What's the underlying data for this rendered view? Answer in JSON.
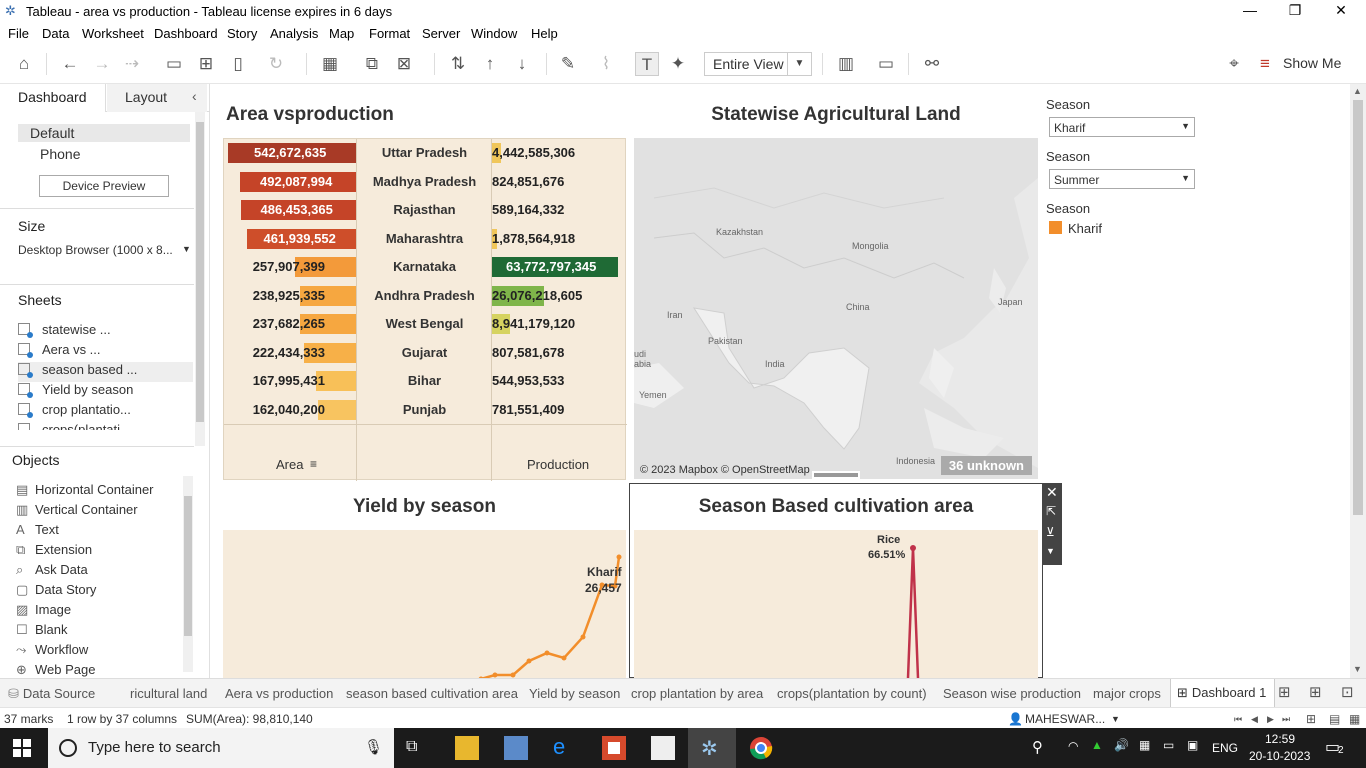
{
  "window": {
    "title": "Tableau - area vs production - Tableau license expires in 6 days"
  },
  "menu": [
    "File",
    "Data",
    "Worksheet",
    "Dashboard",
    "Story",
    "Analysis",
    "Map",
    "Format",
    "Server",
    "Window",
    "Help"
  ],
  "toolbar": {
    "fit": "Entire View",
    "show_me": "Show Me"
  },
  "left": {
    "tab_dashboard": "Dashboard",
    "tab_layout": "Layout",
    "device_default": "Default",
    "device_phone": "Phone",
    "device_preview": "Device Preview",
    "size_label": "Size",
    "size_value": "Desktop Browser (1000 x 8...",
    "sheets_label": "Sheets",
    "sheets": [
      "statewise ...",
      "Aera vs ...",
      "season based ...",
      "Yield by season",
      "crop plantatio...",
      "crops(plantati..."
    ],
    "objects_label": "Objects",
    "objects": [
      {
        "icon": "▤",
        "label": "Horizontal Container"
      },
      {
        "icon": "▥",
        "label": "Vertical Container"
      },
      {
        "icon": "A",
        "label": "Text"
      },
      {
        "icon": "⧉",
        "label": "Extension"
      },
      {
        "icon": "⌕",
        "label": "Ask Data"
      },
      {
        "icon": "▢",
        "label": "Data Story"
      },
      {
        "icon": "▨",
        "label": "Image"
      },
      {
        "icon": "☐",
        "label": "Blank"
      },
      {
        "icon": "⤳",
        "label": "Workflow"
      },
      {
        "icon": "⊕",
        "label": "Web Page"
      }
    ]
  },
  "area_vs_production": {
    "title": "Area vsproduction",
    "area_header": "Area",
    "production_header": "Production",
    "rows": [
      {
        "state": "Uttar Pradesh",
        "area": "542,672,635",
        "production": "4,442,585,306",
        "area_color": "#a83a26",
        "prod_color": "#f0c65a"
      },
      {
        "state": "Madhya Pradesh",
        "area": "492,087,994",
        "production": "824,851,676",
        "area_color": "#c54428",
        "prod_color": ""
      },
      {
        "state": "Rajasthan",
        "area": "486,453,365",
        "production": "589,164,332",
        "area_color": "#c54428",
        "prod_color": ""
      },
      {
        "state": "Maharashtra",
        "area": "461,939,552",
        "production": "1,878,564,918",
        "area_color": "#ce4e2a",
        "prod_color": "#f0c65a"
      },
      {
        "state": "Karnataka",
        "area": "257,907,399",
        "production": "63,772,797,345",
        "area_color": "#f39a3a",
        "prod_color": "#1f6a35"
      },
      {
        "state": "Andhra Pradesh",
        "area": "238,925,335",
        "production": "26,076,218,605",
        "area_color": "#f6a740",
        "prod_color": "#7fb54a"
      },
      {
        "state": "West Bengal",
        "area": "237,682,265",
        "production": "8,941,179,120",
        "area_color": "#f6a740",
        "prod_color": "#d6d360"
      },
      {
        "state": "Gujarat",
        "area": "222,434,333",
        "production": "807,581,678",
        "area_color": "#f7b048",
        "prod_color": ""
      },
      {
        "state": "Bihar",
        "area": "167,995,431",
        "production": "544,953,533",
        "area_color": "#f8c058",
        "prod_color": ""
      },
      {
        "state": "Punjab",
        "area": "162,040,200",
        "production": "781,551,409",
        "area_color": "#f8c460",
        "prod_color": ""
      }
    ]
  },
  "map": {
    "title": "Statewise Agricultural Land",
    "credit": "© 2023 Mapbox © OpenStreetMap",
    "unknown": "36 unknown",
    "labels": [
      {
        "t": "Kazakhstan"
      },
      {
        "t": "Mongolia"
      },
      {
        "t": "China"
      },
      {
        "t": "Japan"
      },
      {
        "t": "Iran"
      },
      {
        "t": "Pakistan"
      },
      {
        "t": "India"
      },
      {
        "t": "udi\nabia"
      },
      {
        "t": "Yemen"
      },
      {
        "t": "Indonesia"
      }
    ]
  },
  "yield": {
    "title": "Yield by season",
    "series_label": "Kharif",
    "series_value": "26,457"
  },
  "cultivation": {
    "title": "Season Based cultivation area",
    "peak_label": "Rice",
    "peak_value": "66.51%"
  },
  "filters": [
    {
      "label": "Season",
      "value": "Kharif"
    },
    {
      "label": "Season",
      "value": "Summer"
    }
  ],
  "legend": {
    "label": "Season",
    "item": "Kharif",
    "color": "#f28e2b"
  },
  "sheet_tabs": [
    "Data Source",
    "ricultural land",
    "Aera vs production",
    "season based cultivation area",
    "Yield by season",
    "crop plantation by area",
    "crops(plantation by count)",
    "Season wise production",
    "major crops",
    "Dashboard 1"
  ],
  "status": {
    "marks": "37 marks",
    "layout": "1 row by 37 columns",
    "sum": "SUM(Area): 98,810,140",
    "user": "MAHESWAR..."
  },
  "taskbar": {
    "search": "Type here to search",
    "lang": "ENG",
    "time": "12:59",
    "date": "20-10-2023",
    "notif": "2"
  },
  "chart_data": [
    {
      "type": "table",
      "title": "Area vsproduction",
      "columns": [
        "Area",
        "State",
        "Production"
      ],
      "rows": [
        [
          "542,672,635",
          "Uttar Pradesh",
          "4,442,585,306"
        ],
        [
          "492,087,994",
          "Madhya Pradesh",
          "824,851,676"
        ],
        [
          "486,453,365",
          "Rajasthan",
          "589,164,332"
        ],
        [
          "461,939,552",
          "Maharashtra",
          "1,878,564,918"
        ],
        [
          "257,907,399",
          "Karnataka",
          "63,772,797,345"
        ],
        [
          "238,925,335",
          "Andhra Pradesh",
          "26,076,218,605"
        ],
        [
          "237,682,265",
          "West Bengal",
          "8,941,179,120"
        ],
        [
          "222,434,333",
          "Gujarat",
          "807,581,678"
        ],
        [
          "167,995,431",
          "Bihar",
          "544,953,533"
        ],
        [
          "162,040,200",
          "Punjab",
          "781,551,409"
        ]
      ]
    },
    {
      "type": "line",
      "title": "Yield by season",
      "series": [
        {
          "name": "Kharif",
          "values": [
            0,
            700,
            1400,
            1400,
            4400,
            6200,
            5000,
            9500,
            20400,
            20300,
            26457
          ]
        }
      ],
      "annotation": "Kharif 26,457"
    },
    {
      "type": "line",
      "title": "Season Based cultivation area",
      "annotation": "Rice 66.51%"
    }
  ]
}
